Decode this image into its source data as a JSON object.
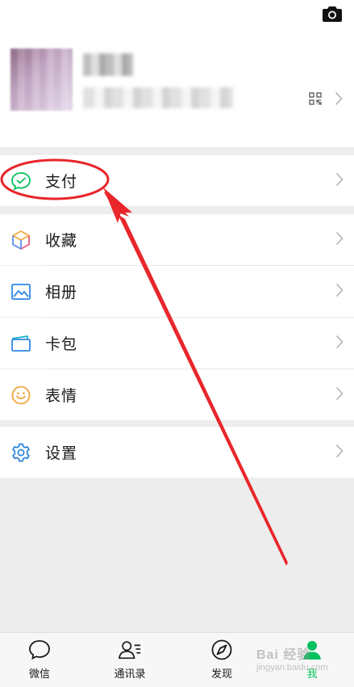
{
  "menu": {
    "pay": {
      "label": "支付"
    },
    "favorites": {
      "label": "收藏"
    },
    "album": {
      "label": "相册"
    },
    "cards": {
      "label": "卡包"
    },
    "stickers": {
      "label": "表情"
    },
    "settings": {
      "label": "设置"
    }
  },
  "tabbar": {
    "tabs": [
      {
        "label": "微信",
        "icon": "chat-bubble-icon"
      },
      {
        "label": "通讯录",
        "icon": "contacts-icon"
      },
      {
        "label": "发现",
        "icon": "compass-icon"
      },
      {
        "label": "我",
        "icon": "person-icon"
      }
    ]
  },
  "watermark": {
    "brand": "Bai 经验",
    "url": "jingyan.baidu.com"
  },
  "colors": {
    "accent": "#07c160",
    "annotation": "#e8262b",
    "background": "#ededed",
    "pay_icon": "#07c160",
    "settings_icon": "#2782d7"
  }
}
